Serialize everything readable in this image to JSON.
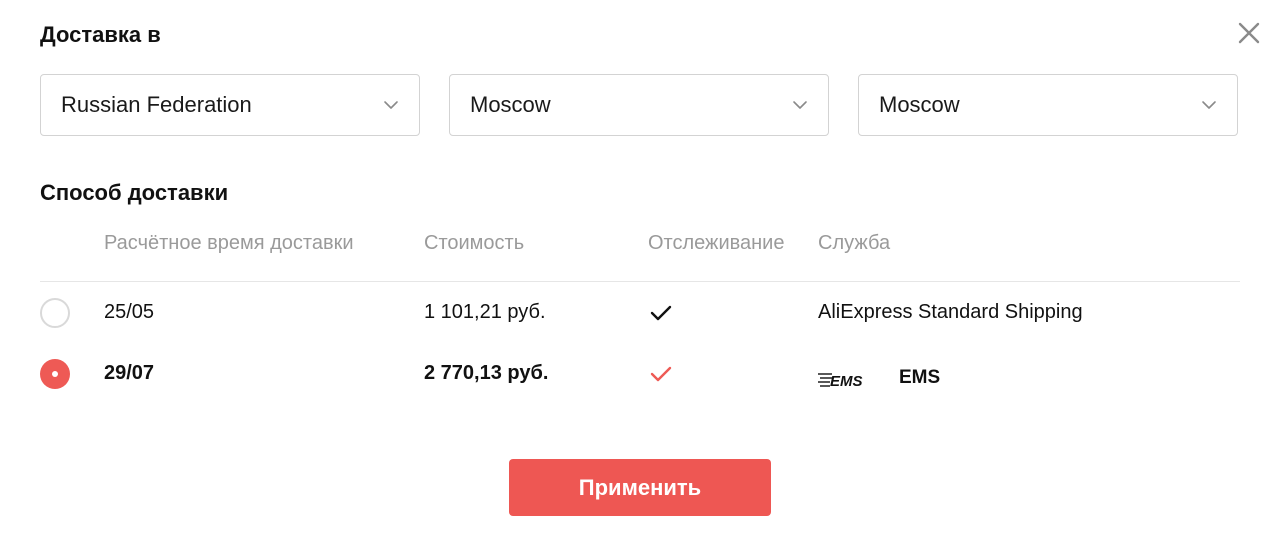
{
  "header": {
    "title": "Доставка в"
  },
  "location": {
    "country": "Russian Federation",
    "region": "Moscow",
    "city": "Moscow"
  },
  "shipping": {
    "title": "Способ доставки",
    "columns": {
      "time": "Расчётное время доставки",
      "cost": "Стоимость",
      "tracking": "Отслеживание",
      "service": "Служба"
    },
    "rows": [
      {
        "selected": false,
        "date": "25/05",
        "cost": "1 101,21 руб.",
        "tracking": true,
        "service": "AliExpress Standard Shipping"
      },
      {
        "selected": true,
        "date": "29/07",
        "cost": "2 770,13 руб.",
        "tracking": true,
        "service": "EMS",
        "service_logo": "EMS"
      }
    ]
  },
  "actions": {
    "apply_label": "Применить"
  },
  "colors": {
    "accent": "#ee5753",
    "border": "#d3d3d3",
    "muted": "#9a9a9a"
  }
}
